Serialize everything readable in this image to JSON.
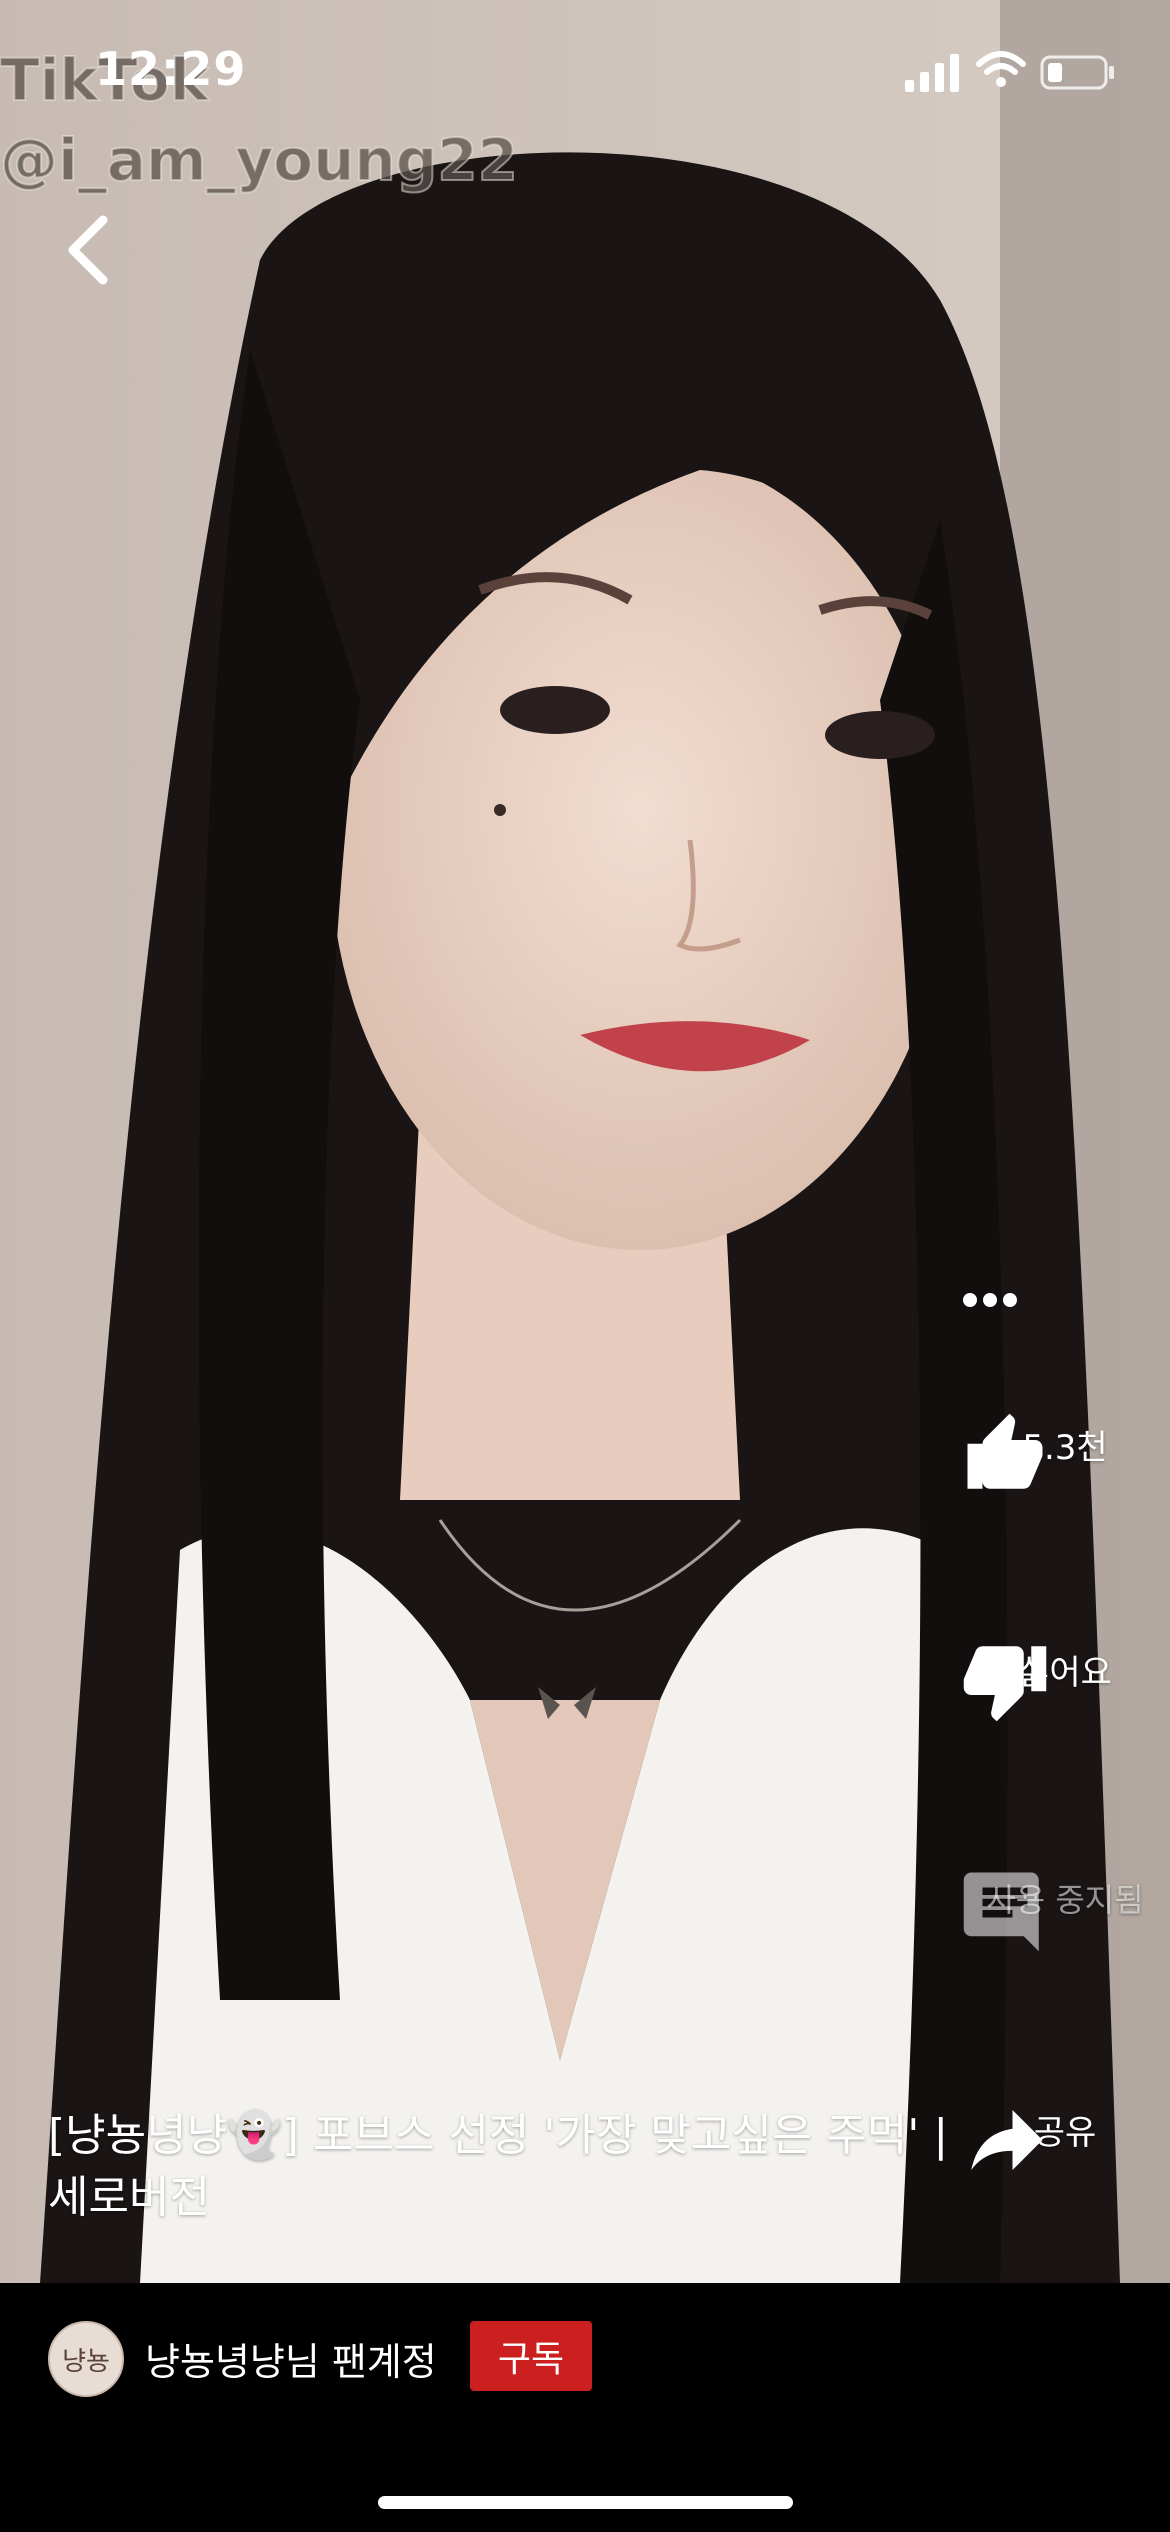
{
  "status_bar": {
    "time": "12:29"
  },
  "watermark": {
    "line1": "TikTok",
    "line2": "@i_am_young22"
  },
  "video": {
    "title": "[냥뇽녕냥👻] 포브스 선정 '가장 맞고싶은 주먹' | 세로버전"
  },
  "actions": {
    "more_icon": "more-horizontal-icon",
    "like": {
      "icon": "thumbs-up-icon",
      "label": "5.3천"
    },
    "dislike": {
      "icon": "thumbs-down-icon",
      "label": "싫어요"
    },
    "comments": {
      "icon": "comment-icon",
      "label": "사용 중지됨"
    },
    "share": {
      "icon": "share-icon",
      "label": "공유"
    }
  },
  "channel": {
    "avatar_text": "냥뇽",
    "name": "냥뇽녕냥님 팬계정",
    "subscribe_label": "구독",
    "subscribe_color": "#cc1f1f"
  }
}
